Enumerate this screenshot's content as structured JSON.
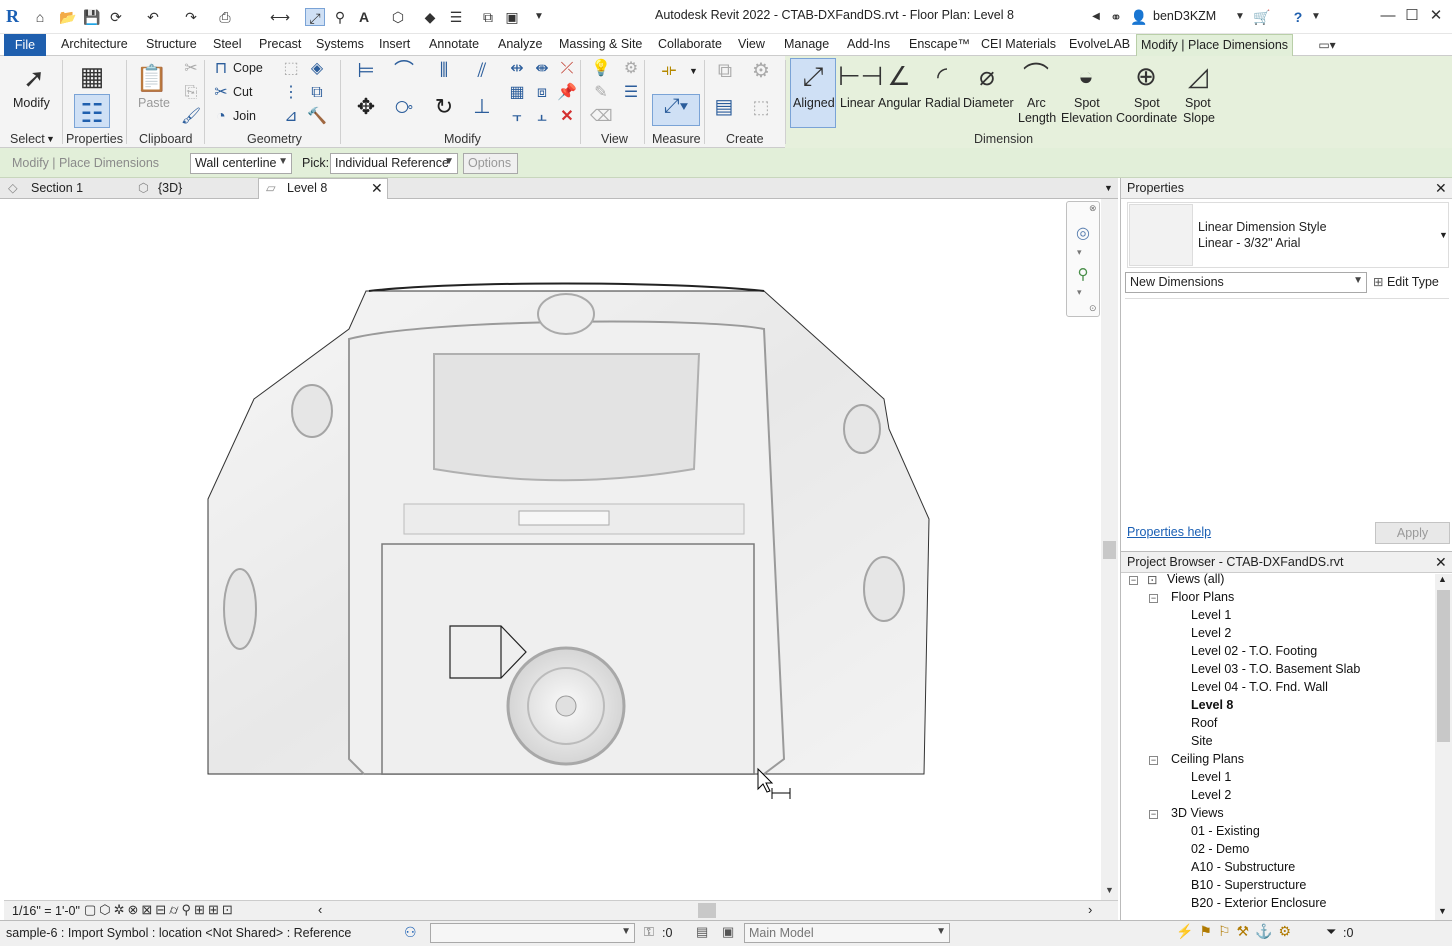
{
  "title": {
    "app_title": "Autodesk Revit 2022 - CTAB-DXFandDS.rvt - Floor Plan: Level 8",
    "user": "benD3KZM",
    "logo": "R"
  },
  "menu": {
    "file": "File",
    "items": [
      "Architecture",
      "Structure",
      "Steel",
      "Precast",
      "Systems",
      "Insert",
      "Annotate",
      "Analyze",
      "Massing & Site",
      "Collaborate",
      "View",
      "Manage",
      "Add-Ins",
      "Enscape™",
      "CEI Materials",
      "EvolveLAB"
    ],
    "active": "Modify | Place Dimensions"
  },
  "ribbon": {
    "select": {
      "modify": "Modify",
      "panel": "Select"
    },
    "properties": {
      "label": "Properties",
      "panel": "Properties"
    },
    "clipboard": {
      "paste": "Paste",
      "panel": "Clipboard"
    },
    "geometry": {
      "cope": "Cope",
      "cut": "Cut",
      "join": "Join",
      "panel": "Geometry"
    },
    "modify_panel": "Modify",
    "view_panel": "View",
    "measure_panel": "Measure",
    "create_panel": "Create",
    "dimension": {
      "panel": "Dimension",
      "tools": [
        {
          "line1": "Aligned",
          "line2": ""
        },
        {
          "line1": "Linear",
          "line2": ""
        },
        {
          "line1": "Angular",
          "line2": ""
        },
        {
          "line1": "Radial",
          "line2": ""
        },
        {
          "line1": "Diameter",
          "line2": ""
        },
        {
          "line1": "Arc",
          "line2": "Length"
        },
        {
          "line1": "Spot",
          "line2": "Elevation"
        },
        {
          "line1": "Spot",
          "line2": "Coordinate"
        },
        {
          "line1": "Spot",
          "line2": "Slope"
        }
      ]
    }
  },
  "options_bar": {
    "context": "Modify | Place Dimensions",
    "placement": "Wall centerline",
    "pick_label": "Pick:",
    "pick_value": "Individual Reference",
    "options_button": "Options"
  },
  "view_tabs": [
    {
      "label": "Section 1"
    },
    {
      "label": "{3D}"
    },
    {
      "label": "Level 8"
    }
  ],
  "properties": {
    "header": "Properties",
    "type_line1": "Linear Dimension Style",
    "type_line2": "Linear - 3/32\" Arial",
    "filter": "New Dimensions",
    "edit_type": "Edit Type",
    "help": "Properties help",
    "apply": "Apply"
  },
  "browser": {
    "header": "Project Browser - CTAB-DXFandDS.rvt",
    "root": "Views (all)",
    "floor_plans": "Floor Plans",
    "floor_items": [
      "Level 1",
      "Level 2",
      "Level 02 - T.O. Footing",
      "Level 03 - T.O. Basement Slab",
      "Level 04 - T.O. Fnd. Wall",
      "Level 8",
      "Roof",
      "Site"
    ],
    "ceiling_plans": "Ceiling Plans",
    "ceiling_items": [
      "Level 1",
      "Level 2"
    ],
    "views_3d": "3D Views",
    "views_3d_items": [
      "01 - Existing",
      "02 - Demo",
      "A10 - Substructure",
      "B10 - Superstructure",
      "B20 - Exterior Enclosure"
    ]
  },
  "view_bar": {
    "scale": "1/16\" = 1'-0\""
  },
  "status": {
    "message": "sample-6 : Import Symbol : location <Not Shared> : Reference",
    "counter": ":0",
    "model": "Main Model",
    "filter_count": ":0"
  }
}
